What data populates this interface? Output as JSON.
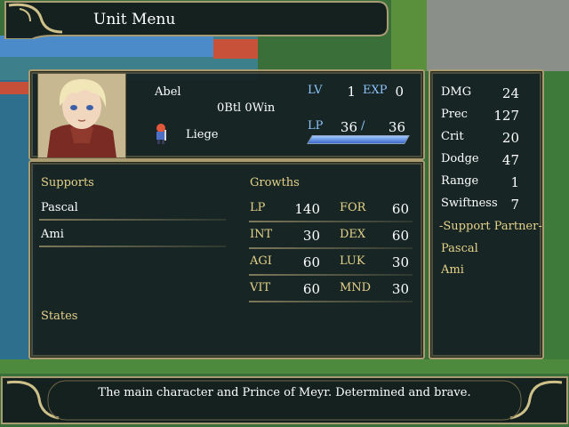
{
  "menu": {
    "title": "Unit Menu"
  },
  "unit": {
    "name": "Abel",
    "record": "0Btl 0Win",
    "class": "Liege",
    "lv_label": "LV",
    "lv": "1",
    "exp_label": "EXP",
    "exp": "0",
    "lp_label": "LP",
    "lp_current": "36",
    "lp_sep": "/",
    "lp_max": "36",
    "lp_fill": 1.0
  },
  "supports": {
    "title": "Supports",
    "items": [
      "Pascal",
      "Ami"
    ]
  },
  "states": {
    "title": "States"
  },
  "growths": {
    "title": "Growths",
    "stats": [
      {
        "label": "LP",
        "value": "140"
      },
      {
        "label": "FOR",
        "value": "60"
      },
      {
        "label": "INT",
        "value": "30"
      },
      {
        "label": "DEX",
        "value": "60"
      },
      {
        "label": "AGI",
        "value": "60"
      },
      {
        "label": "LUK",
        "value": "30"
      },
      {
        "label": "VIT",
        "value": "60"
      },
      {
        "label": "MND",
        "value": "30"
      }
    ]
  },
  "combat": {
    "stats": [
      {
        "label": "DMG",
        "value": "24"
      },
      {
        "label": "Prec",
        "value": "127"
      },
      {
        "label": "Crit",
        "value": "20"
      },
      {
        "label": "Dodge",
        "value": "47"
      },
      {
        "label": "Range",
        "value": "1"
      },
      {
        "label": "Swiftness",
        "value": "7"
      }
    ],
    "support_partner_title": "-Support Partner-",
    "partners": [
      "Pascal",
      "Ami"
    ]
  },
  "help": {
    "text": "The main character and Prince of Meyr. Determined and brave."
  },
  "colors": {
    "gold": "#e6d28a",
    "blue": "#8ec4ff",
    "panel": "#142022",
    "frame": "#a99c72"
  }
}
